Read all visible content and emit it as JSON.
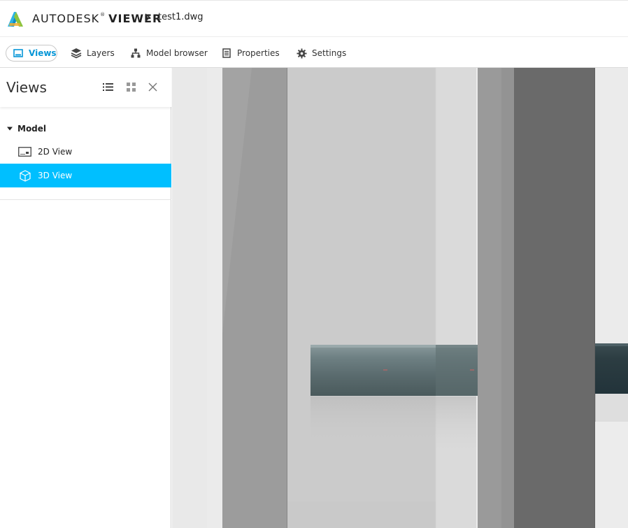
{
  "app": {
    "brand_first": "AUTODESK",
    "brand_reg": "®",
    "brand_second": "VIEWER",
    "file_name": "test1.dwg"
  },
  "toolbar": {
    "items": [
      {
        "label": "Views",
        "icon": "views-icon",
        "active": true
      },
      {
        "label": "Layers",
        "icon": "layers-icon"
      },
      {
        "label": "Model browser",
        "icon": "model-browser-icon"
      },
      {
        "label": "Properties",
        "icon": "properties-icon"
      },
      {
        "label": "Settings",
        "icon": "gear-icon"
      }
    ]
  },
  "panel": {
    "title": "Views",
    "tree": {
      "group_label": "Model",
      "items": [
        {
          "label": "2D View",
          "icon": "2d-sheet-icon",
          "selected": false
        },
        {
          "label": "3D View",
          "icon": "3d-cube-icon",
          "selected": true
        }
      ]
    }
  },
  "colors": {
    "accent": "#0696d7",
    "selection": "#00bfff"
  }
}
